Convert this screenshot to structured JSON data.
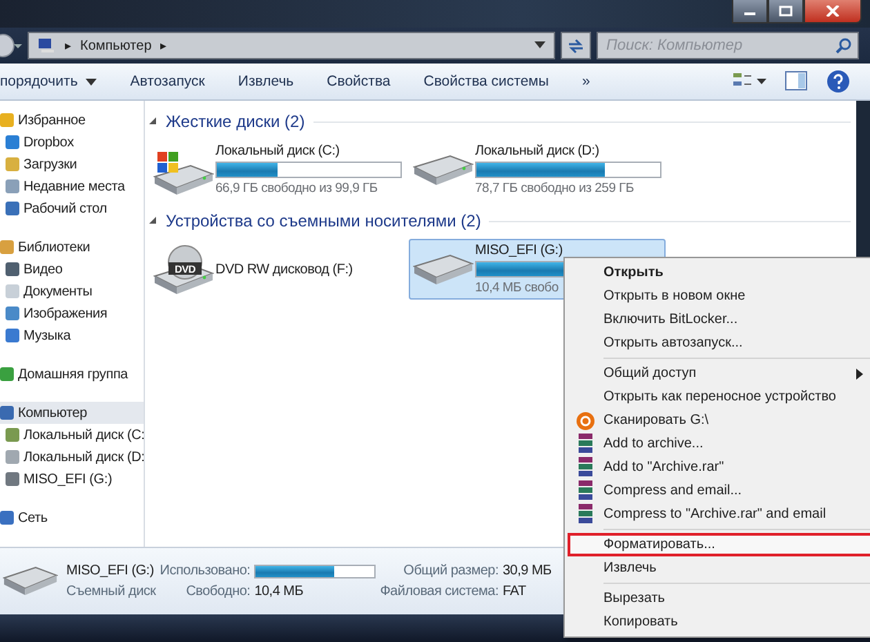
{
  "address_bar": {
    "arrow_before": "▸",
    "path": "Компьютер",
    "arrow_after": "▸"
  },
  "search": {
    "placeholder": "Поиск: Компьютер"
  },
  "toolbar": {
    "items": [
      {
        "label": "порядочить",
        "dropdown": true
      },
      {
        "label": "Автозапуск",
        "dropdown": false
      },
      {
        "label": "Извлечь",
        "dropdown": false
      },
      {
        "label": "Свойства",
        "dropdown": false
      },
      {
        "label": "Свойства системы",
        "dropdown": false
      },
      {
        "label": "»",
        "dropdown": false
      }
    ]
  },
  "sidebar": {
    "groups": [
      {
        "label": "Избранное",
        "kind": "star",
        "selected": false,
        "children": [
          {
            "label": "Dropbox",
            "kind": "dropbox",
            "selected": false
          },
          {
            "label": "Загрузки",
            "kind": "folder",
            "selected": false
          },
          {
            "label": "Недавние места",
            "kind": "recent",
            "selected": false
          },
          {
            "label": "Рабочий стол",
            "kind": "desktop",
            "selected": false
          }
        ]
      },
      {
        "label": "Библиотеки",
        "kind": "library",
        "selected": false,
        "children": [
          {
            "label": "Видео",
            "kind": "video",
            "selected": false
          },
          {
            "label": "Документы",
            "kind": "doc",
            "selected": false
          },
          {
            "label": "Изображения",
            "kind": "image",
            "selected": false
          },
          {
            "label": "Музыка",
            "kind": "music",
            "selected": false
          }
        ]
      },
      {
        "label": "Домашняя группа",
        "kind": "homegroup",
        "selected": false
      },
      {
        "label": "Компьютер",
        "kind": "computer",
        "selected": true,
        "children": [
          {
            "label": "Локальный диск (C:",
            "kind": "sysdrive",
            "selected": false
          },
          {
            "label": "Локальный диск (D:",
            "kind": "drive",
            "selected": false
          },
          {
            "label": "MISO_EFI (G:)",
            "kind": "usb",
            "selected": false
          }
        ]
      },
      {
        "label": "Сеть",
        "kind": "network",
        "selected": false
      }
    ]
  },
  "sections": [
    {
      "title": "Жесткие диски (2)",
      "drives": [
        {
          "name": "Локальный диск (C:)",
          "kind": "sysdrive",
          "level": 0.33,
          "free": "66,9 ГБ свободно из 99,9 ГБ",
          "selected": false
        },
        {
          "name": "Локальный диск (D:)",
          "kind": "drive",
          "level": 0.7,
          "free": "78,7 ГБ свободно из 259 ГБ",
          "selected": false
        }
      ]
    },
    {
      "title": "Устройства со съемными носителями (2)",
      "drives": [
        {
          "name": "DVD RW дисковод (F:)",
          "kind": "dvd",
          "badge": "DVD",
          "selected": false
        },
        {
          "name": "MISO_EFI (G:)",
          "kind": "usb",
          "level": 0.66,
          "free": "10,4 МБ свобо",
          "selected": true
        }
      ]
    }
  ],
  "details": {
    "name": "MISO_EFI (G:)",
    "type": "Съемный диск",
    "used_label": "Использовано:",
    "level": 0.66,
    "free_label": "Свободно:",
    "free_value": "10,4 МБ",
    "total_label": "Общий размер:",
    "total_value": "30,9 МБ",
    "fs_label": "Файловая система:",
    "fs_value": "FAT"
  },
  "context_menu": {
    "groups": [
      [
        {
          "label": "Открыть",
          "kind": "plain",
          "default": true,
          "submenu": false,
          "highlighted": false
        },
        {
          "label": "Открыть в новом окне",
          "kind": "plain",
          "default": false,
          "submenu": false,
          "highlighted": false
        },
        {
          "label": "Включить BitLocker...",
          "kind": "plain",
          "default": false,
          "submenu": false,
          "highlighted": false
        },
        {
          "label": "Открыть автозапуск...",
          "kind": "plain",
          "default": false,
          "submenu": false,
          "highlighted": false
        }
      ],
      [
        {
          "label": "Общий доступ",
          "kind": "plain",
          "default": false,
          "submenu": true,
          "highlighted": false
        },
        {
          "label": "Открыть как переносное устройство",
          "kind": "plain",
          "default": false,
          "submenu": false,
          "highlighted": false
        },
        {
          "label": "Сканировать G:\\",
          "kind": "scan",
          "default": false,
          "submenu": false,
          "highlighted": false
        },
        {
          "label": "Add to archive...",
          "kind": "rar",
          "default": false,
          "submenu": false,
          "highlighted": false
        },
        {
          "label": "Add to \"Archive.rar\"",
          "kind": "rar",
          "default": false,
          "submenu": false,
          "highlighted": false
        },
        {
          "label": "Compress and email...",
          "kind": "rar",
          "default": false,
          "submenu": false,
          "highlighted": false
        },
        {
          "label": "Compress to \"Archive.rar\" and email",
          "kind": "rar",
          "default": false,
          "submenu": false,
          "highlighted": false
        }
      ],
      [
        {
          "label": "Форматировать...",
          "kind": "plain",
          "default": false,
          "submenu": false,
          "highlighted": true
        },
        {
          "label": "Извлечь",
          "kind": "plain",
          "default": false,
          "submenu": false,
          "highlighted": false
        }
      ],
      [
        {
          "label": "Вырезать",
          "kind": "plain",
          "default": false,
          "submenu": false,
          "highlighted": false
        },
        {
          "label": "Копировать",
          "kind": "plain",
          "default": false,
          "submenu": false,
          "highlighted": false
        }
      ]
    ]
  }
}
